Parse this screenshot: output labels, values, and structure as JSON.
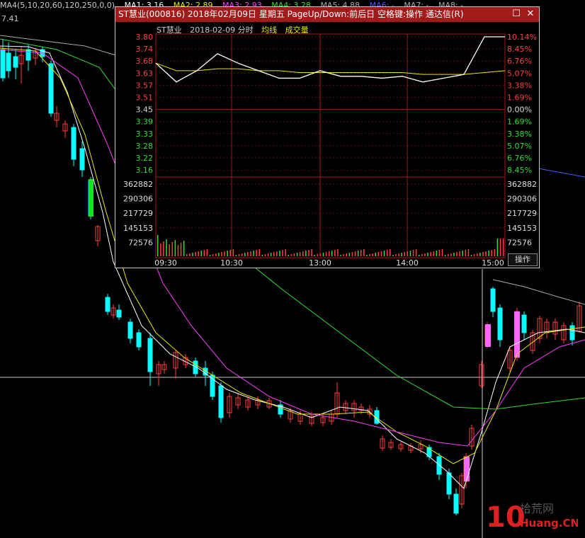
{
  "window": {
    "title": "ST慧业(000816)  2018年02月09日  星期五  PageUp/Down:前后日  空格键:操作  通达信(R)"
  },
  "ma_bar": {
    "label": "MA4(5,10,20,60,120,250,0,0)",
    "items": [
      {
        "text": "MA1: 3.16",
        "color": "#ffffff"
      },
      {
        "text": "MA2: 2.89",
        "color": "#e6e600"
      },
      {
        "text": "MA3: 2.93",
        "color": "#ff3cff"
      },
      {
        "text": "MA4: 3.28",
        "color": "#33dd33"
      },
      {
        "text": "MA5: 4.88",
        "color": "#aaaaaa"
      },
      {
        "text": "MA6: -",
        "color": "#5555ff"
      },
      {
        "text": "MA7: -",
        "color": "#aaaaaa"
      },
      {
        "text": "MA8: -",
        "color": "#aaaaaa"
      }
    ]
  },
  "left_price": "7.41",
  "intraday": {
    "stock": "ST慧业",
    "date": "2018-02-09  分时",
    "avg_label": "均线",
    "vol_label": "成交量",
    "price_ticks": [
      "3.80",
      "3.74",
      "3.68",
      "3.63",
      "3.57",
      "3.51",
      "3.45",
      "3.39",
      "3.33",
      "3.28",
      "3.22",
      "3.16"
    ],
    "pct_ticks": [
      "10.14%",
      "8.45%",
      "6.76%",
      "5.07%",
      "3.38%",
      "1.69%",
      "0.00%",
      "1.69%",
      "3.38%",
      "5.07%",
      "6.76%",
      "8.45%"
    ],
    "vol_ticks": [
      "362882",
      "290306",
      "217729",
      "145153",
      "72576"
    ],
    "time_ticks": [
      "09:30",
      "10:30",
      "13:00",
      "14:00",
      "15:00"
    ],
    "prev_close": 3.45,
    "op_button": "操作"
  },
  "chart_data": [
    {
      "type": "line",
      "title": "ST慧业 2018-02-09 分时",
      "x": [
        "09:30",
        "09:45",
        "10:00",
        "10:15",
        "10:30",
        "10:45",
        "11:00",
        "11:15",
        "11:30/13:00",
        "13:15",
        "13:30",
        "13:45",
        "14:00",
        "14:15",
        "14:30",
        "14:45",
        "14:55",
        "15:00"
      ],
      "series": [
        {
          "name": "price",
          "values": [
            3.66,
            3.56,
            3.62,
            3.71,
            3.66,
            3.62,
            3.58,
            3.58,
            3.62,
            3.59,
            3.59,
            3.58,
            3.59,
            3.56,
            3.58,
            3.6,
            3.8,
            3.8
          ]
        },
        {
          "name": "均线",
          "values": [
            3.66,
            3.62,
            3.62,
            3.63,
            3.63,
            3.62,
            3.62,
            3.61,
            3.61,
            3.61,
            3.61,
            3.61,
            3.61,
            3.6,
            3.6,
            3.6,
            3.61,
            3.62
          ]
        }
      ],
      "ylim": [
        3.1,
        3.8
      ]
    },
    {
      "type": "bar",
      "title": "成交量",
      "ylim": [
        0,
        362882
      ]
    }
  ],
  "watermark": {
    "number": "10",
    "site": "拾荒网",
    "domain": "Huang.CN"
  }
}
